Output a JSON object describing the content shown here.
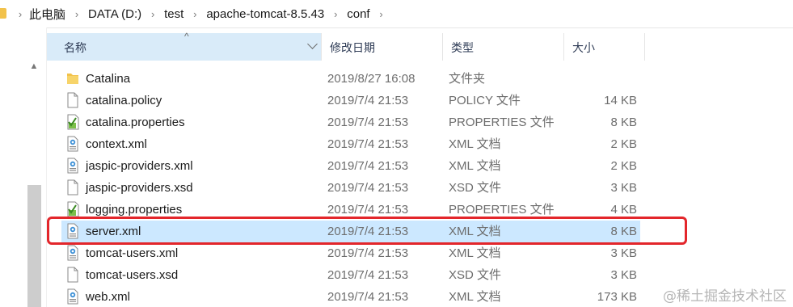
{
  "breadcrumb": {
    "items": [
      "此电脑",
      "DATA (D:)",
      "test",
      "apache-tomcat-8.5.43",
      "conf"
    ],
    "separator": "›"
  },
  "columns": {
    "name": "名称",
    "date": "修改日期",
    "type": "类型",
    "size": "大小"
  },
  "files": [
    {
      "name": "Catalina",
      "date": "2019/8/27 16:08",
      "type": "文件夹",
      "size": "",
      "icon": "folder-icon"
    },
    {
      "name": "catalina.policy",
      "date": "2019/7/4 21:53",
      "type": "POLICY 文件",
      "size": "14 KB",
      "icon": "file-icon"
    },
    {
      "name": "catalina.properties",
      "date": "2019/7/4 21:53",
      "type": "PROPERTIES 文件",
      "size": "8 KB",
      "icon": "properties-file-icon"
    },
    {
      "name": "context.xml",
      "date": "2019/7/4 21:53",
      "type": "XML 文档",
      "size": "2 KB",
      "icon": "xml-file-icon"
    },
    {
      "name": "jaspic-providers.xml",
      "date": "2019/7/4 21:53",
      "type": "XML 文档",
      "size": "2 KB",
      "icon": "xml-file-icon"
    },
    {
      "name": "jaspic-providers.xsd",
      "date": "2019/7/4 21:53",
      "type": "XSD 文件",
      "size": "3 KB",
      "icon": "file-icon"
    },
    {
      "name": "logging.properties",
      "date": "2019/7/4 21:53",
      "type": "PROPERTIES 文件",
      "size": "4 KB",
      "icon": "properties-file-icon"
    },
    {
      "name": "server.xml",
      "date": "2019/7/4 21:53",
      "type": "XML 文档",
      "size": "8 KB",
      "icon": "xml-file-icon",
      "selected": true
    },
    {
      "name": "tomcat-users.xml",
      "date": "2019/7/4 21:53",
      "type": "XML 文档",
      "size": "3 KB",
      "icon": "xml-file-icon"
    },
    {
      "name": "tomcat-users.xsd",
      "date": "2019/7/4 21:53",
      "type": "XSD 文件",
      "size": "3 KB",
      "icon": "file-icon"
    },
    {
      "name": "web.xml",
      "date": "2019/7/4 21:53",
      "type": "XML 文档",
      "size": "173 KB",
      "icon": "xml-file-icon"
    }
  ],
  "watermark": "@稀土掘金技术社区",
  "colors": {
    "selection": "#cce8ff",
    "header_active": "#d9ebf9",
    "highlight_border": "#e3262b",
    "folder": "#f2c24b"
  }
}
